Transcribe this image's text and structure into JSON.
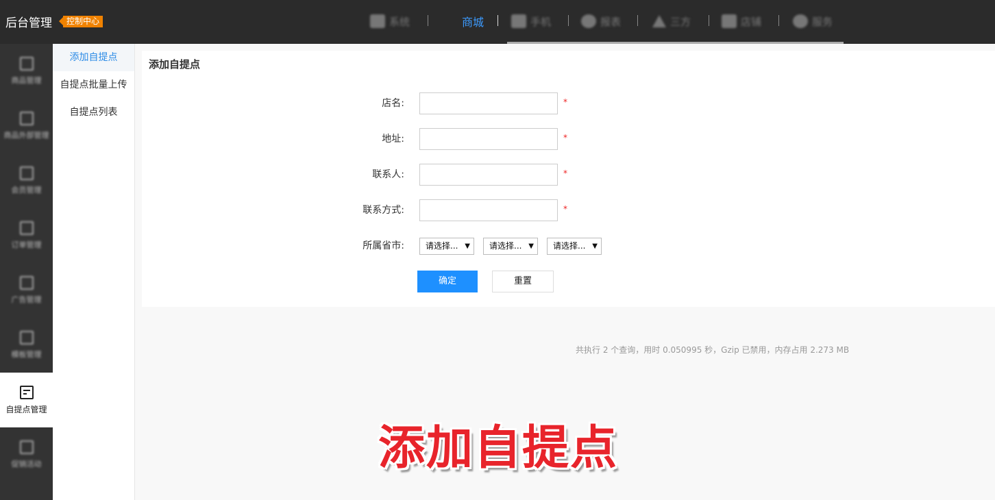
{
  "header": {
    "brand": "后台管理",
    "badge": "控制中心",
    "nav": {
      "system": "系统",
      "mall": "商城",
      "mobile": "手机",
      "reports": "报表",
      "thirdparty": "三方",
      "shop": "店铺",
      "service": "服务"
    }
  },
  "sidebar": {
    "items": [
      {
        "label": "商品管理"
      },
      {
        "label": "商品外部管理"
      },
      {
        "label": "会员管理"
      },
      {
        "label": "订单管理"
      },
      {
        "label": "广告管理"
      },
      {
        "label": "模板管理"
      },
      {
        "label": "自提点管理"
      },
      {
        "label": "促销活动"
      }
    ]
  },
  "submenu": {
    "items": [
      {
        "label": "添加自提点"
      },
      {
        "label": "自提点批量上传"
      },
      {
        "label": "自提点列表"
      }
    ]
  },
  "form": {
    "title": "添加自提点",
    "fields": {
      "name": {
        "label": "店名:",
        "value": ""
      },
      "address": {
        "label": "地址:",
        "value": ""
      },
      "contact": {
        "label": "联系人:",
        "value": ""
      },
      "phone": {
        "label": "联系方式:",
        "value": ""
      }
    },
    "required_mark": "*",
    "region": {
      "label": "所属省市:",
      "province": "请选择...",
      "city": "请选择...",
      "district": "请选择..."
    },
    "submit": "确定",
    "reset": "重置"
  },
  "footer": {
    "stats": "共执行 2 个查询，用时 0.050995 秒，Gzip 已禁用，内存占用 2.273 MB"
  },
  "overlay": {
    "caption": "添加自提点"
  },
  "colors": {
    "accent": "#1e90ff",
    "topbar": "#2b2b2b",
    "sidebar": "#333333",
    "badge": "#f08200",
    "required": "#ee2222",
    "caption": "#e8242b"
  }
}
